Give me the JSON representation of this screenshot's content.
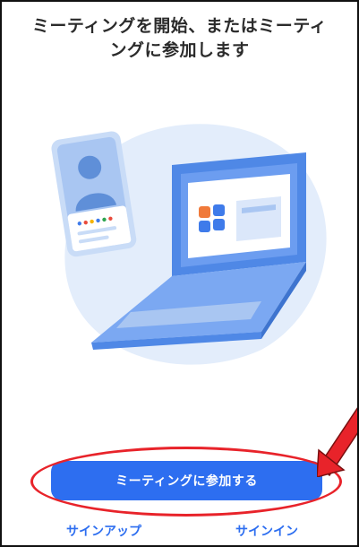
{
  "header": {
    "title_line1": "ミーティングを開始、またはミーティ",
    "title_line2": "ングに参加します"
  },
  "actions": {
    "join_meeting_label": "ミーティングに参加する",
    "sign_up_label": "サインアップ",
    "sign_in_label": "サインイン"
  },
  "colors": {
    "accent": "#2d6ef0",
    "annotation": "#e8232a",
    "illustration_bg": "#e3edfb"
  },
  "icons": {
    "illustration": "laptop-and-contact-card-illustration",
    "annotation": "red-arrow-pointer"
  }
}
